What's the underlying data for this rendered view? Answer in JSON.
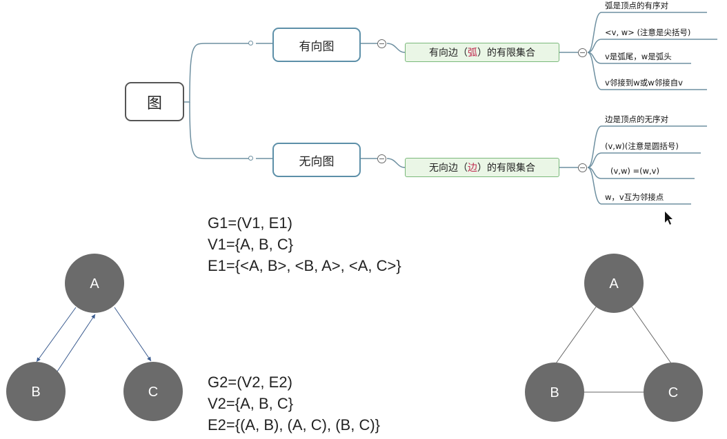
{
  "mindmap": {
    "root": "图",
    "directed": {
      "title": "有向图",
      "definition_parts": [
        "有向边（",
        "弧",
        "）的有限集合"
      ],
      "leaves": [
        "弧是顶点的有序对",
        "<v, w> (注意是尖括号)",
        "v是弧尾，w是弧头",
        "v邻接到w或w邻接自v"
      ]
    },
    "undirected": {
      "title": "无向图",
      "definition_parts": [
        "无向边（",
        "边",
        "）的有限集合"
      ],
      "leaves": [
        "边是顶点的无序对",
        "(v,w)(注意是圆括号)",
        "(v,w) =(w,v)",
        "w，v互为邻接点"
      ]
    }
  },
  "formulas": {
    "g1": [
      "G1=(V1, E1)",
      "V1={A, B, C}",
      "E1={<A, B>, <B, A>, <A, C>}"
    ],
    "g2": [
      "G2=(V2, E2)",
      "V2={A, B, C}",
      "E2={(A, B), (A, C), (B, C)}"
    ]
  },
  "graph_left": {
    "nodes": [
      "A",
      "B",
      "C"
    ],
    "arcs": [
      [
        "A",
        "B"
      ],
      [
        "B",
        "A"
      ],
      [
        "A",
        "C"
      ]
    ]
  },
  "graph_right": {
    "nodes": [
      "A",
      "B",
      "C"
    ],
    "edges": [
      [
        "A",
        "B"
      ],
      [
        "A",
        "C"
      ],
      [
        "B",
        "C"
      ]
    ]
  },
  "colors": {
    "node_fill": "#6b6b6b",
    "connector": "#6d8fa0",
    "definition_fill": "#eaf6e6",
    "highlight": "#c0294f"
  }
}
